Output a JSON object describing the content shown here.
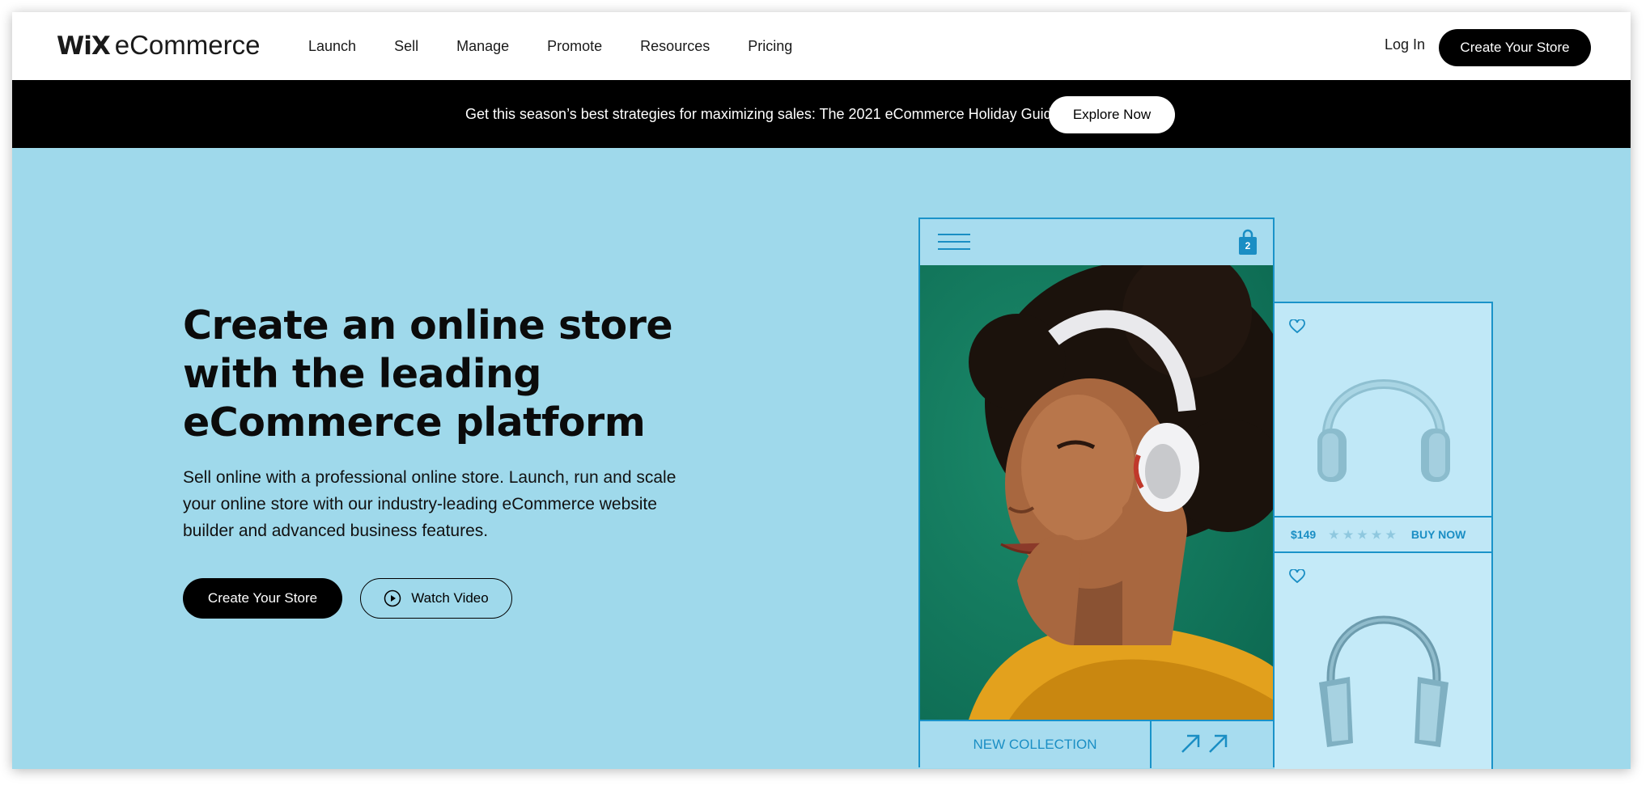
{
  "header": {
    "logo_mark": "WiX",
    "logo_text": "eCommerce",
    "nav": [
      {
        "label": "Launch"
      },
      {
        "label": "Sell"
      },
      {
        "label": "Manage"
      },
      {
        "label": "Promote"
      },
      {
        "label": "Resources"
      },
      {
        "label": "Pricing"
      }
    ],
    "login_label": "Log In",
    "cta_label": "Create Your Store"
  },
  "banner": {
    "text": "Get this season’s best strategies for maximizing sales: The 2021 eCommerce Holiday Guide.",
    "button_label": "Explore Now"
  },
  "hero": {
    "title": "Create an online store with the leading eCommerce platform",
    "subtitle": "Sell online with a professional online store. Launch, run and scale your online store with our industry-leading eCommerce website builder and advanced business features.",
    "cta_label": "Create Your Store",
    "video_label": "Watch Video"
  },
  "mockup": {
    "cart_count": "2",
    "collection_label": "NEW COLLECTION",
    "product": {
      "price": "$149",
      "stars": "★★★★★",
      "buy_label": "BUY NOW"
    }
  },
  "colors": {
    "hero_bg": "#9fd9eb",
    "accent": "#1a93c9",
    "banner_bg": "#000000",
    "photo_bg": "#117a5e"
  },
  "icons": [
    "play-icon",
    "menu-icon",
    "shopping-bag-icon",
    "heart-icon",
    "arrow-up-right-icon",
    "headphones-icon"
  ]
}
